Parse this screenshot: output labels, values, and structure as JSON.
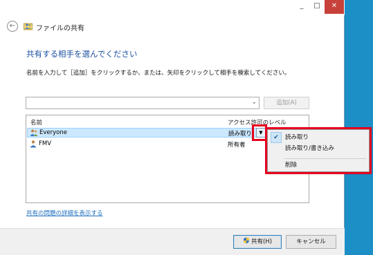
{
  "window": {
    "minimize": "_",
    "maximize": "□",
    "close": "✕"
  },
  "nav": {
    "back_glyph": "←",
    "title": "ファイルの共有"
  },
  "heading": "共有する相手を選んでください",
  "instructions": "名前を入力して［追加］をクリックするか、または、矢印をクリックして相手を検索してください。",
  "combo": {
    "value": "",
    "arrow": "⌄"
  },
  "add_button": "追加(A)",
  "list": {
    "headers": {
      "name": "名前",
      "access": "アクセス許可のレベル"
    },
    "rows": [
      {
        "name": "Everyone",
        "permission": "読み取り",
        "selected": true
      },
      {
        "name": "FMV",
        "permission": "所有者",
        "selected": false
      }
    ],
    "dropdown_glyph": "▼"
  },
  "menu": {
    "items": [
      {
        "label": "読み取り",
        "checked": true
      },
      {
        "label": "読み取り/書き込み",
        "checked": false
      },
      {
        "label": "削除",
        "checked": false
      }
    ],
    "check_glyph": "✔"
  },
  "link": "共有の問題の詳細を表示する",
  "buttons": {
    "share": "共有(H)",
    "cancel": "キャンセル"
  },
  "colors": {
    "highlight": "#e6001e",
    "heading": "#1b4fa0",
    "link": "#1e6fbf",
    "desktop": "#1c8fc7"
  }
}
